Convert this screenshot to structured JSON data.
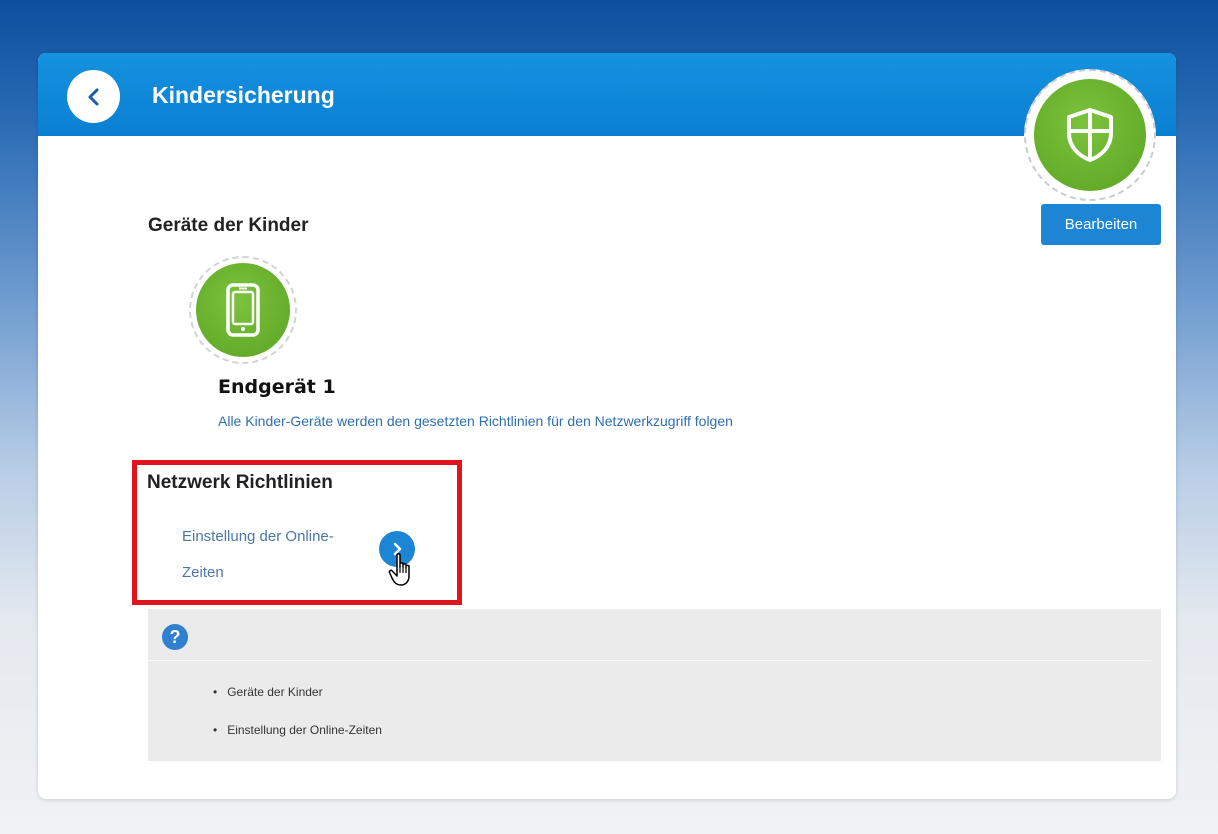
{
  "header": {
    "title": "Kindersicherung"
  },
  "actions": {
    "edit_label": "Bearbeiten"
  },
  "children_devices": {
    "title": "Geräte der Kinder",
    "device_name": "Endgerät 1",
    "description": "Alle Kinder-Geräte werden den gesetzten Richtlinien für den Netzwerkzugriff folgen"
  },
  "network_policies": {
    "title": "Netzwerk Richtlinien",
    "online_times_label_line1": "Einstellung der Online-",
    "online_times_label_line2": "Zeiten"
  },
  "help": {
    "items": [
      "Geräte der Kinder",
      "Einstellung der Online-Zeiten"
    ]
  },
  "colors": {
    "header_blue": "#0a7fd1",
    "accent_green": "#6ab42c",
    "button_blue": "#1c86d4",
    "highlight_red": "#e0141d",
    "link_blue": "#2f6fb3"
  },
  "icons": {
    "back": "chevron-left-icon",
    "shield": "shield-icon",
    "device": "smartphone-icon",
    "arrow": "chevron-right-icon",
    "help": "question-icon",
    "cursor": "hand-pointer-icon"
  }
}
